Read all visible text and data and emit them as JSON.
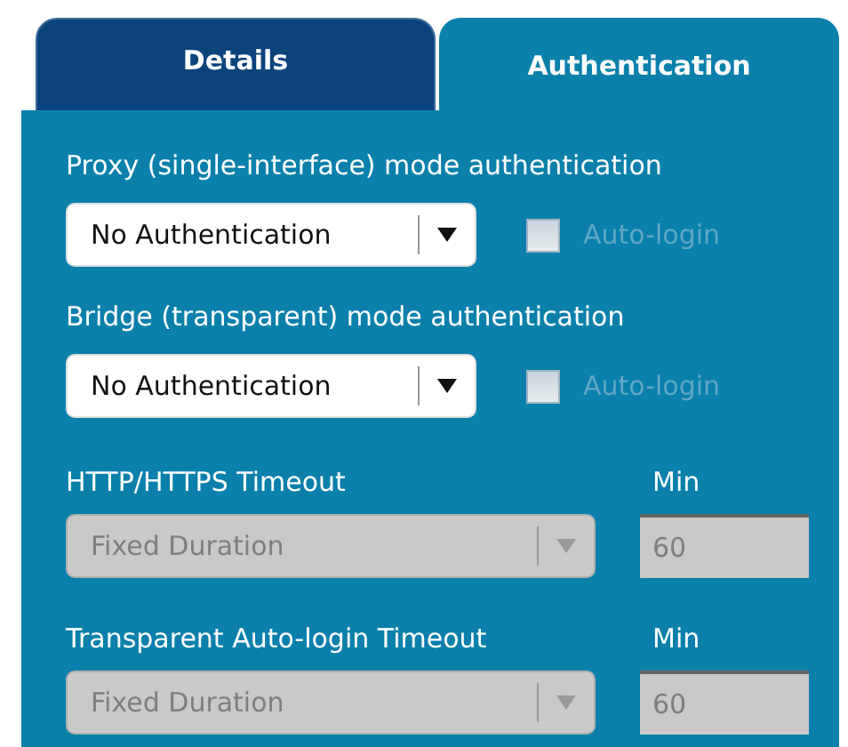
{
  "tabs": [
    {
      "label": "Details",
      "selected": false
    },
    {
      "label": "Authentication",
      "selected": true
    }
  ],
  "sections": [
    {
      "kind": "auth",
      "label": "Proxy (single-interface) mode authentication",
      "select": {
        "value": "No Authentication",
        "disabled": false
      },
      "checkbox": {
        "label": "Auto-login",
        "checked": false,
        "disabled": true
      }
    },
    {
      "kind": "auth",
      "label": "Bridge (transparent) mode authentication",
      "select": {
        "value": "No Authentication",
        "disabled": false
      },
      "checkbox": {
        "label": "Auto-login",
        "checked": false,
        "disabled": true
      }
    },
    {
      "kind": "timeout",
      "label": "HTTP/HTTPS Timeout",
      "unit_label": "Min",
      "select": {
        "value": "Fixed Duration",
        "disabled": true
      },
      "field": {
        "value": "60",
        "disabled": true
      }
    },
    {
      "kind": "timeout",
      "label": "Transparent Auto-login Timeout",
      "unit_label": "Min",
      "select": {
        "value": "Fixed Duration",
        "disabled": true
      },
      "field": {
        "value": "60",
        "disabled": true
      }
    }
  ]
}
